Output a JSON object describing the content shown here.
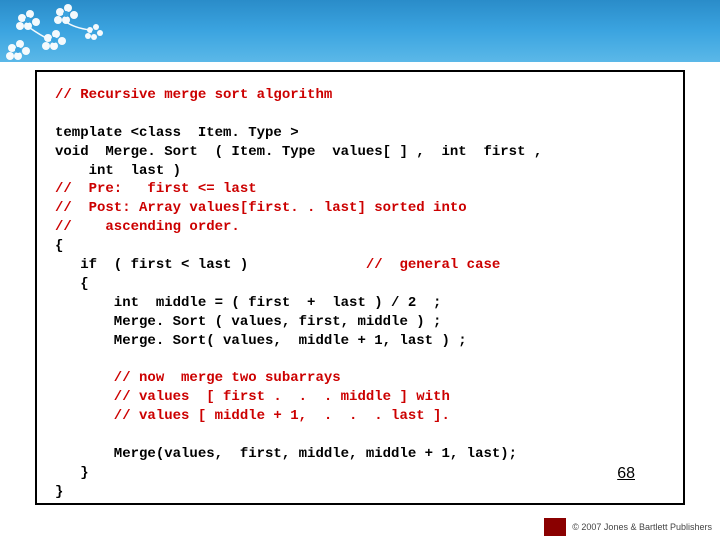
{
  "slide": {
    "pageNumber": "68",
    "copyright": "© 2007 Jones & Bartlett Publishers"
  },
  "code": {
    "l1": "// Recursive merge sort algorithm",
    "l2": "template <class  Item. Type >",
    "l3": "void  Merge. Sort  ( Item. Type  values[ ] ,  int  first ,",
    "l4": "    int  last )",
    "l5": "//  Pre:   first <= last",
    "l6": "//  Post: Array values[first. . last] sorted into",
    "l7": "//    ascending order.",
    "l8": "{",
    "l9a": "   if  ( first < last )              ",
    "l9b": "//  general case",
    "l10": "   {",
    "l11": "       int  middle = ( first  +  last ) / 2  ;",
    "l12": "       Merge. Sort ( values, first, middle ) ;",
    "l13": "       Merge. Sort( values,  middle + 1, last ) ;",
    "l14": "       // now  merge two subarrays",
    "l15": "       // values  [ first .  .  . middle ] with",
    "l16": "       // values [ middle + 1,  .  .  . last ].",
    "l17": "       Merge(values,  first, middle, middle + 1, last);",
    "l18": "   }",
    "l19": "}"
  }
}
